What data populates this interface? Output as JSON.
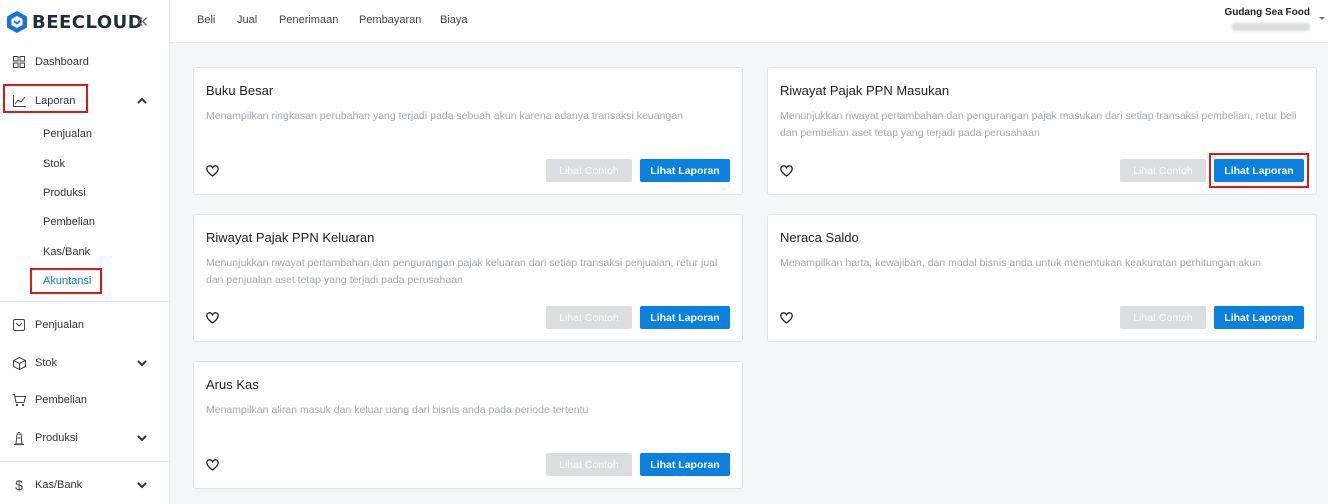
{
  "brand": {
    "name": "BEECLOUD",
    "collapse_glyph": "«"
  },
  "sidebar": {
    "dashboard": "Dashboard",
    "laporan": "Laporan",
    "laporan_sub": [
      "Penjualan",
      "Stok",
      "Produksi",
      "Pembelian",
      "Kas/Bank",
      "Akuntansi"
    ],
    "penjualan": "Penjualan",
    "stok": "Stok",
    "pembelian": "Pembelian",
    "produksi": "Produksi",
    "kasbank": "Kas/Bank"
  },
  "topbar": {
    "menu": [
      "Beli",
      "Jual",
      "Penerimaan",
      "Pembayaran",
      "Biaya"
    ],
    "company": "Gudang Sea Food"
  },
  "cards": [
    {
      "title": "Buku Besar",
      "desc": "Menampilkan ringkasan perubahan yang terjadi pada sebuah akun karena adanya transaksi keuangan",
      "contoh": "Lihat Contoh",
      "lihat": "Lihat Laporan"
    },
    {
      "title": "Riwayat Pajak PPN Masukan",
      "desc": "Menunjukkan riwayat pertambahan dan pengurangan pajak masukan dari setiap transaksi pembelian, retur beli dan pembelian aset tetap yang terjadi pada perusahaan",
      "contoh": "Lihat Contoh",
      "lihat": "Lihat Laporan"
    },
    {
      "title": "Riwayat Pajak PPN Keluaran",
      "desc": "Menunjukkan riwayat pertambahan dan pengurangan pajak keluaran dari setiap transaksi penjualan, retur jual dan penjualan aset tetap yang terjadi pada perusahaan",
      "contoh": "Lihat Contoh",
      "lihat": "Lihat Laporan"
    },
    {
      "title": "Neraca Saldo",
      "desc": "Menampilkan harta, kewajiban, dan modal bisnis anda untuk menentukan keakuratan perhitungan akun",
      "contoh": "Lihat Contoh",
      "lihat": "Lihat Laporan"
    },
    {
      "title": "Arus Kas",
      "desc": "Menampilkan aliran masuk dan keluar uang dari bisnis anda pada periode tertentu",
      "contoh": "Lihat Contoh",
      "lihat": "Lihat Laporan"
    }
  ],
  "colors": {
    "primary": "#0a80e0",
    "highlight": "#d71920",
    "active_sub": "#0a80e0"
  }
}
